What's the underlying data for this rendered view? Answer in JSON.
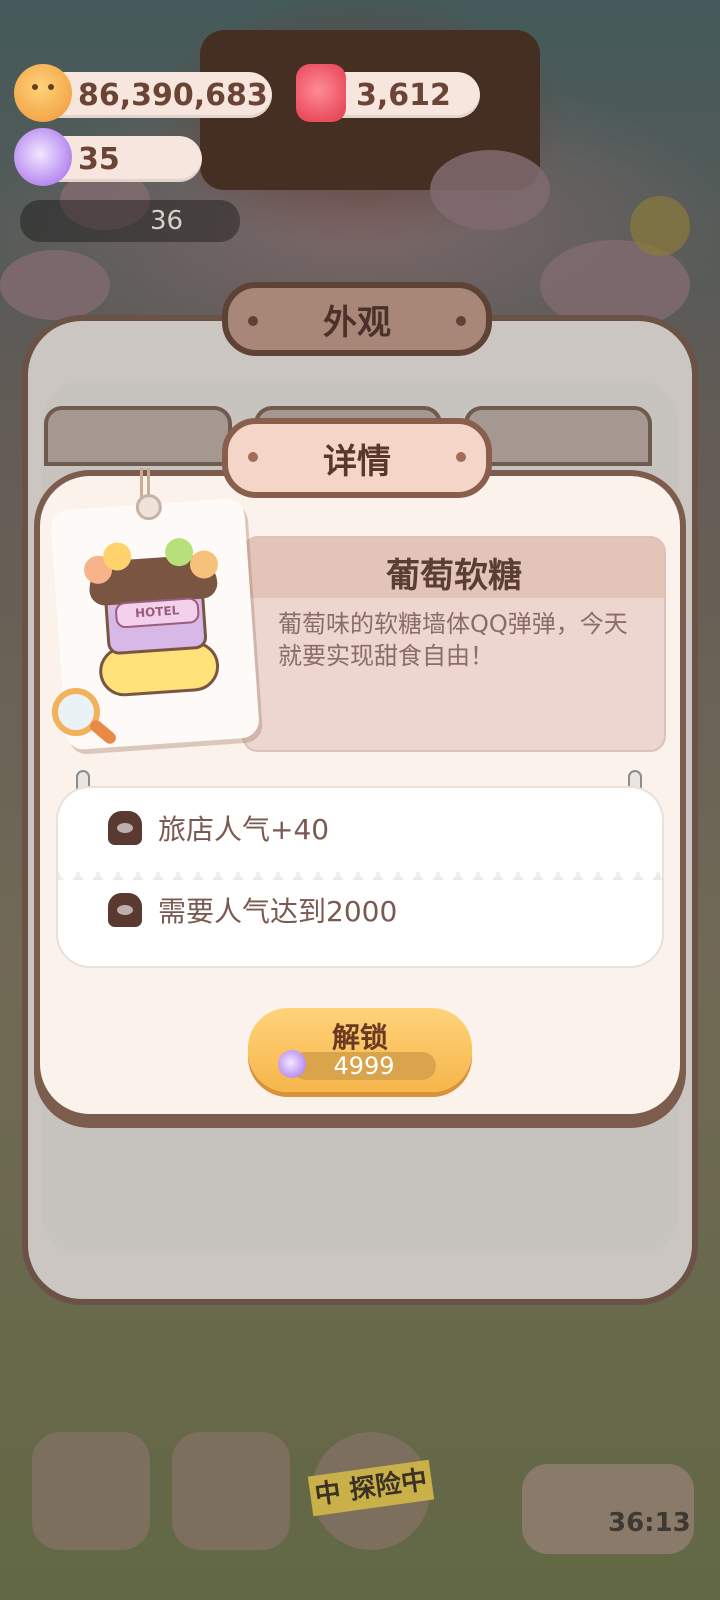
{
  "currencies": {
    "cookies": "86,390,683",
    "candles": "3,612",
    "candy": "35"
  },
  "announcement_count": "36",
  "outer_panel": {
    "title": "外观"
  },
  "detail_dialog": {
    "title": "详情",
    "item_name": "葡萄软糖",
    "item_image_sign": "HOTEL",
    "description": "葡萄味的软糖墙体QQ弹弹，今天就要实现甜食自由！",
    "stats": [
      {
        "icon": "muffin-icon",
        "text": "旅店人气+40"
      },
      {
        "icon": "muffin-icon",
        "text": "需要人气达到2000"
      }
    ],
    "unlock_button": {
      "label": "解锁",
      "price": "4999",
      "currency_icon": "candy-icon"
    }
  },
  "bottom_bar": {
    "explore_label": "中 探险中",
    "timer": "36:13"
  },
  "colors": {
    "panel_border": "#6a5346",
    "dialog_body": "#fbf2ec",
    "button": "#f6b64b",
    "text_brown": "#5a3d33"
  }
}
